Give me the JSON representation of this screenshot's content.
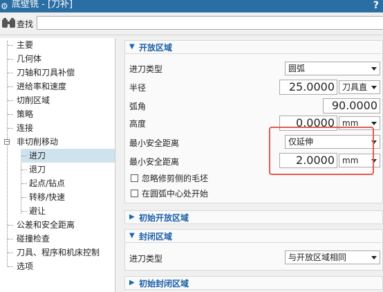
{
  "window": {
    "title": "底壁铣 - [刀补]",
    "help": "?"
  },
  "search": {
    "label": "查找",
    "value": ""
  },
  "tree": {
    "items": [
      {
        "label": "主要"
      },
      {
        "label": "几何体"
      },
      {
        "label": "刀轴和刀具补偿"
      },
      {
        "label": "进给率和速度"
      },
      {
        "label": "切削区域"
      },
      {
        "label": "策略"
      },
      {
        "label": "连接"
      },
      {
        "label": "非切削移动"
      },
      {
        "label": "进刀"
      },
      {
        "label": "退刀"
      },
      {
        "label": "起点/钻点"
      },
      {
        "label": "转移/快速"
      },
      {
        "label": "避让"
      },
      {
        "label": "公差和安全距离"
      },
      {
        "label": "碰撞检查"
      },
      {
        "label": "刀具、程序和机床控制"
      },
      {
        "label": "选项"
      }
    ],
    "selected": "进刀"
  },
  "open_area": {
    "title": "开放区域",
    "entry_type": {
      "label": "进刀类型",
      "value": "圆弧"
    },
    "radius": {
      "label": "半径",
      "value": "25.0000",
      "unit": "刀具直"
    },
    "arc_angle": {
      "label": "弧角",
      "value": "90.0000"
    },
    "height": {
      "label": "高度",
      "value": "0.0000",
      "unit": "mm"
    },
    "min_clearance_1": {
      "label": "最小安全距离",
      "value": "仅延伸"
    },
    "min_clearance_2": {
      "label": "最小安全距离",
      "value": "2.0000",
      "unit": "mm"
    },
    "ignore_flash": {
      "label": "忽略修剪侧的毛坯"
    },
    "arc_center_start": {
      "label": "在圆弧中心处开始"
    }
  },
  "initial_open_area": {
    "title": "初始开放区域"
  },
  "closed_area": {
    "title": "封闭区域",
    "entry_type": {
      "label": "进刀类型",
      "value": "与开放区域相同"
    }
  },
  "initial_closed_area": {
    "title": "初始封闭区域"
  },
  "colors": {
    "titlebar": "#2b6ea3",
    "accent": "#1a5fa8",
    "highlight": "#e05a4e",
    "selected": "#cfe3ee"
  }
}
